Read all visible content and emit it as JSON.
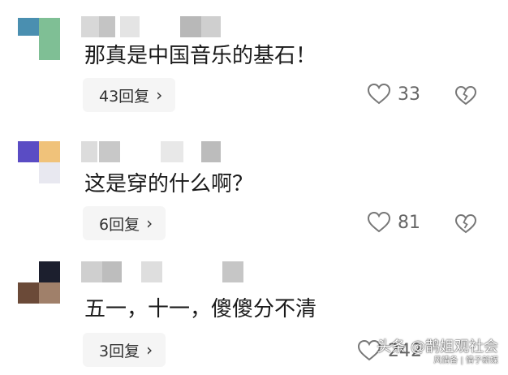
{
  "comments": [
    {
      "text": "那真是中国音乐的基石！",
      "replies_label": "43回复",
      "likes": "33",
      "avatar_colors": [
        "#4a8fb0",
        "#7fbf95"
      ],
      "name_mosaic_colors": [
        "#d8d8d8",
        "#c4c4c4",
        "#e4e4e4",
        "#b8b8b8",
        "#cfcfcf"
      ]
    },
    {
      "text": "这是穿的什么啊？",
      "replies_label": "6回复",
      "likes": "81",
      "avatar_colors": [
        "#5a4cc4",
        "#f0c27a",
        "#e8e8f0"
      ],
      "name_mosaic_colors": [
        "#dcdcdc",
        "#c8c8c8",
        "#e8e8e8",
        "#bcbcbc"
      ]
    },
    {
      "text": "五一，十一，傻傻分不清",
      "replies_label": "3回复",
      "likes": "242",
      "avatar_colors": [
        "#1c1f2e",
        "#6b4a38",
        "#a0806a"
      ],
      "name_mosaic_colors": [
        "#cfcfcf",
        "#bdbdbd",
        "#dedede",
        "#c6c6c6"
      ]
    }
  ],
  "icons": {
    "chevron": "chevron-right-icon",
    "like": "heart-icon",
    "dislike": "broken-heart-icon"
  },
  "watermark": {
    "main": "头条 @鹊姐观社会",
    "sub": "风情备 | 情子新媒"
  }
}
